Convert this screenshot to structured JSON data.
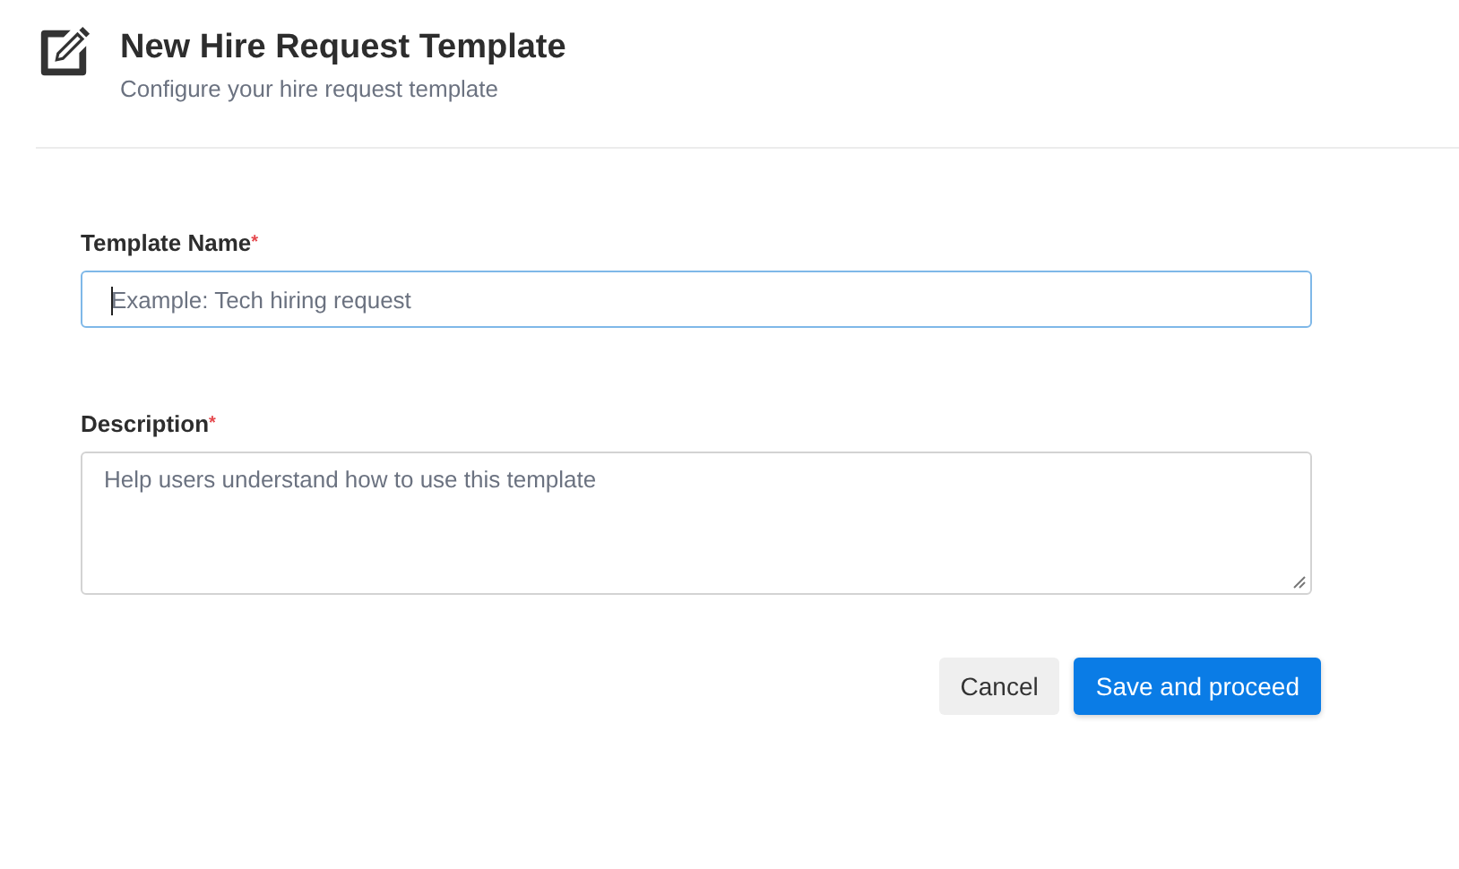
{
  "header": {
    "title": "New Hire Request Template",
    "subtitle": "Configure your hire request template"
  },
  "fields": [
    {
      "kind": "input",
      "label": "Template Name",
      "required_mark": "*",
      "placeholder": "Example: Tech hiring request",
      "focused": true
    },
    {
      "kind": "textarea",
      "label": "Description",
      "required_mark": "*",
      "placeholder": "Help users understand how to use this template",
      "focused": false
    }
  ],
  "buttons": [
    {
      "kind": "secondary",
      "label": "Cancel"
    },
    {
      "kind": "primary",
      "label": "Save and proceed"
    }
  ]
}
